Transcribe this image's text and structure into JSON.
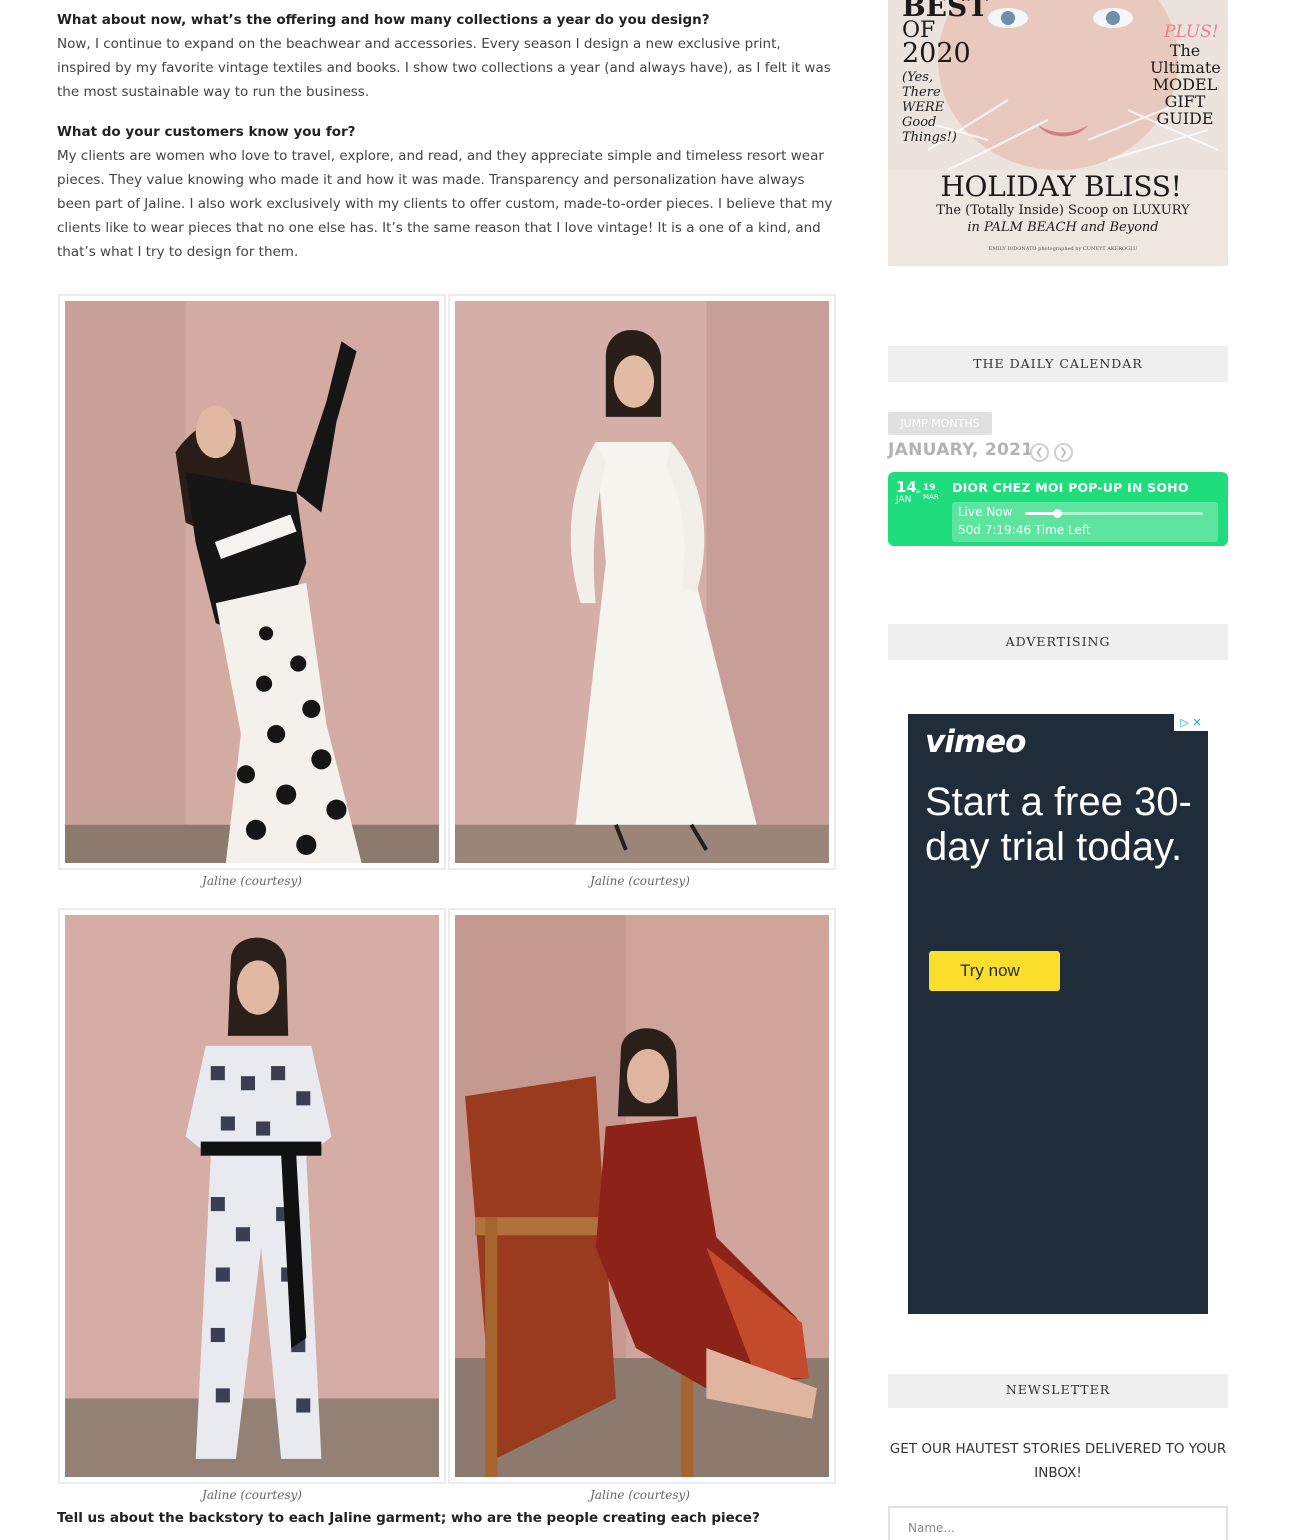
{
  "article": {
    "q1": "What about now, what’s the offering and how many collections a year do you design?",
    "a1": "Now, I continue to expand on the beachwear and accessories. Every season I design a new exclusive print, inspired by my favorite vintage textiles and books.  I show two collections a year (and always have), as I felt it was the most sustainable way to run the business.",
    "q2": "What do your customers know you for?",
    "a2": "My clients are women who love to travel, explore, and read, and they appreciate simple and timeless resort wear pieces.  They value knowing who made it and how it was made. Transparency and personalization have always been part of Jaline. I also work exclusively with my clients to offer custom, made-to-order pieces. I believe that my clients like to wear pieces that no one else has. It’s the same reason that I love vintage! It is a one of a kind, and that’s what I try to design for them.",
    "q3": "Tell us about the backstory to each Jaline garment; who are the people creating each piece?"
  },
  "gallery": {
    "captions": [
      "Jaline (courtesy)",
      "Jaline (courtesy)",
      "Jaline (courtesy)",
      "Jaline (courtesy)"
    ]
  },
  "cover": {
    "best": "BEST",
    "of": "OF",
    "year": "2020",
    "tagline": "(Yes, There WERE Good Things!)",
    "plus": "PLUS!",
    "gift": "The Ultimate MODEL GIFT GUIDE",
    "headline": "HOLIDAY BLISS!",
    "sub1": "The (Totally Inside) Scoop on LUXURY",
    "sub2": "in PALM BEACH and Beyond",
    "credit": "EMILY DIDONATO photographed by CUNEYT AKEROGLU"
  },
  "calendar": {
    "title": "THE DAILY CALENDAR",
    "jump_label": "JUMP MONTHS",
    "month": "JANUARY, 2021",
    "event": {
      "start_day": "14",
      "start_month": "JAN",
      "end_day": "19",
      "end_month": "MAR",
      "title": "DIOR CHEZ MOI POP-UP IN SOHO",
      "live_label": "Live Now",
      "time_left": "50d 7:19:46 Time Left",
      "progress": 0.18,
      "color": "#1fdc7c"
    }
  },
  "advertising": {
    "title": "ADVERTISING",
    "brand": "vimeo",
    "headline": "Start a free 30-day trial today.",
    "cta": "Try now",
    "bg_color": "#1f2d3b",
    "cta_color": "#f9de2c"
  },
  "newsletter": {
    "title": "NEWSLETTER",
    "text": "GET OUR HAUTEST STORIES DELIVERED TO YOUR INBOX!",
    "name_placeholder": "Name..."
  }
}
